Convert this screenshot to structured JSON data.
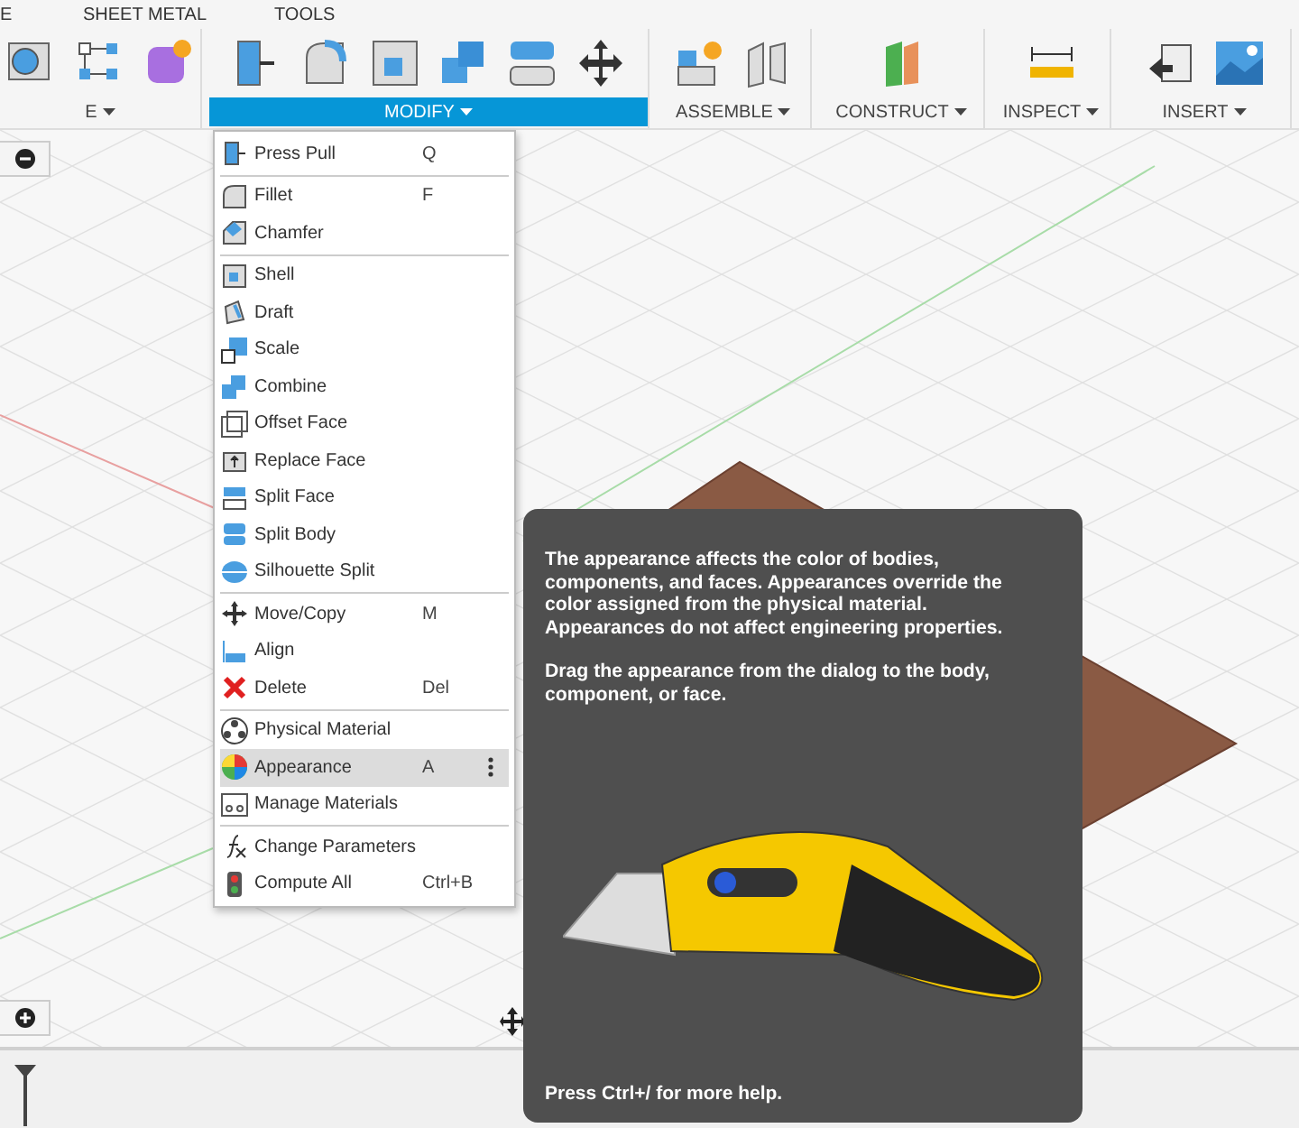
{
  "tabs": [
    {
      "label": "E"
    },
    {
      "label": "SHEET METAL"
    },
    {
      "label": "TOOLS"
    }
  ],
  "groups": [
    {
      "label": "E",
      "selected": false
    },
    {
      "label": "MODIFY",
      "selected": true
    },
    {
      "label": "ASSEMBLE",
      "selected": false
    },
    {
      "label": "CONSTRUCT",
      "selected": false
    },
    {
      "label": "INSPECT",
      "selected": false
    },
    {
      "label": "INSERT",
      "selected": false
    }
  ],
  "menu": {
    "sections": [
      [
        {
          "label": "Press Pull",
          "shortcut": "Q",
          "selected": false
        }
      ],
      [
        {
          "label": "Fillet",
          "shortcut": "F",
          "selected": false
        },
        {
          "label": "Chamfer",
          "selected": false
        }
      ],
      [
        {
          "label": "Shell",
          "selected": false
        },
        {
          "label": "Draft",
          "selected": false
        },
        {
          "label": "Scale",
          "selected": false
        },
        {
          "label": "Combine",
          "selected": false
        },
        {
          "label": "Offset Face",
          "selected": false
        },
        {
          "label": "Replace Face",
          "selected": false
        },
        {
          "label": "Split Face",
          "selected": false
        },
        {
          "label": "Split Body",
          "selected": false
        },
        {
          "label": "Silhouette Split",
          "selected": false
        }
      ],
      [
        {
          "label": "Move/Copy",
          "shortcut": "M",
          "selected": false
        },
        {
          "label": "Align",
          "selected": false
        },
        {
          "label": "Delete",
          "shortcut": "Del",
          "selected": false
        }
      ],
      [
        {
          "label": "Physical Material",
          "selected": false
        },
        {
          "label": "Appearance",
          "shortcut": "A",
          "selected": true
        },
        {
          "label": "Manage Materials",
          "selected": false
        }
      ],
      [
        {
          "label": "Change Parameters",
          "selected": false
        },
        {
          "label": "Compute All",
          "shortcut": "Ctrl+B",
          "selected": false
        }
      ]
    ]
  },
  "tooltip": {
    "paragraphs": [
      "The appearance affects the color of bodies, components, and faces. Appearances override the color assigned from the physical material. Appearances do not affect engineering properties.",
      "Drag the appearance from the dialog to the body, component, or face."
    ],
    "footer": "Press Ctrl+/ for more help."
  }
}
